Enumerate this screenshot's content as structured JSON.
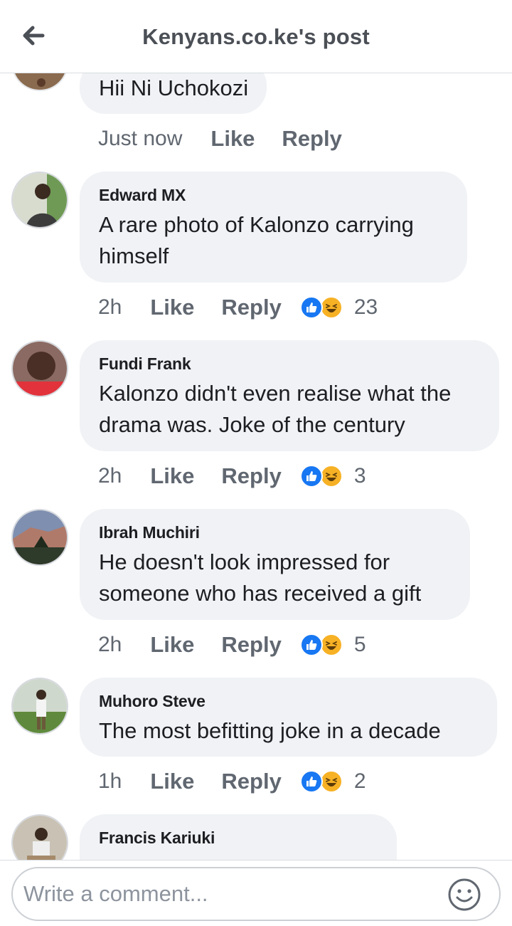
{
  "header": {
    "title": "Kenyans.co.ke's post"
  },
  "partial_comment": {
    "text": "Hii Ni Uchokozi",
    "time": "Just now",
    "like": "Like",
    "reply": "Reply"
  },
  "comments": [
    {
      "author": "Edward MX",
      "text": "A rare photo of Kalonzo  carrying himself",
      "time": "2h",
      "like": "Like",
      "reply": "Reply",
      "reactions": "23"
    },
    {
      "author": "Fundi Frank",
      "text": "Kalonzo didn't even realise what the drama was. Joke of the century",
      "time": "2h",
      "like": "Like",
      "reply": "Reply",
      "reactions": "3"
    },
    {
      "author": "Ibrah Muchiri",
      "text": "He doesn't look impressed for someone who has received a gift",
      "time": "2h",
      "like": "Like",
      "reply": "Reply",
      "reactions": "5"
    },
    {
      "author": "Muhoro Steve",
      "text": "The most befitting joke in a decade",
      "time": "1h",
      "like": "Like",
      "reply": "Reply",
      "reactions": "2"
    },
    {
      "author": "Francis Kariuki"
    }
  ],
  "composer": {
    "placeholder": "Write a comment..."
  },
  "icons": {
    "back": "back-arrow-icon",
    "emoji": "emoji-smiley-icon",
    "like_reaction": "like-reaction-icon",
    "haha_reaction": "haha-reaction-icon"
  },
  "colors": {
    "like_blue": "#1877f2",
    "haha_yellow": "#f7b125",
    "bubble_bg": "#f0f2f5",
    "muted_text": "#606770"
  }
}
